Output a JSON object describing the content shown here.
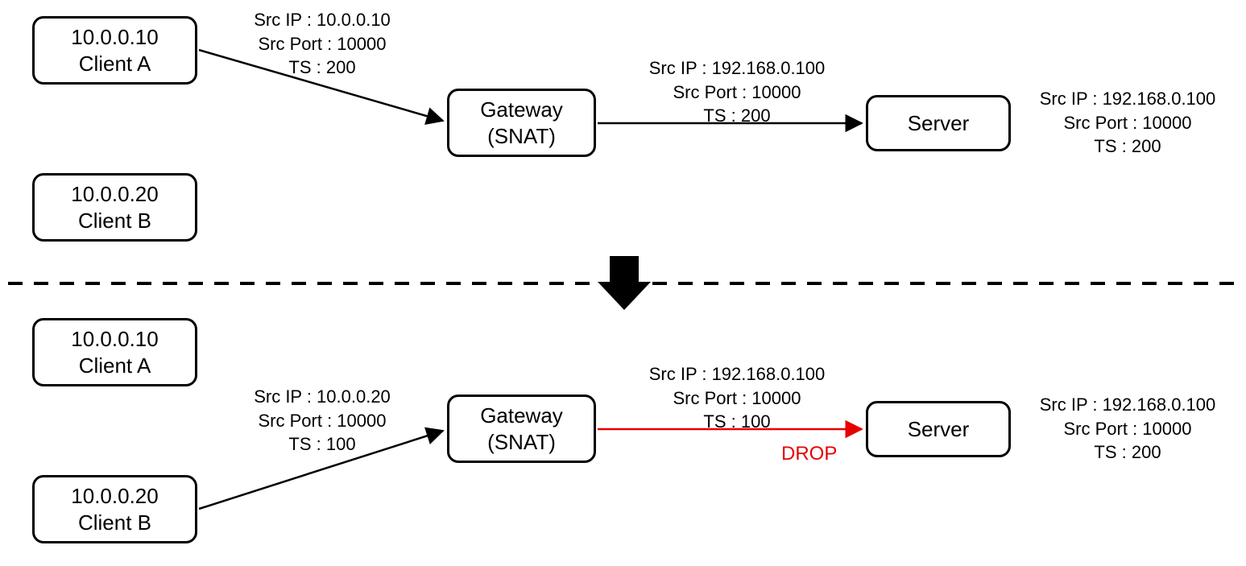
{
  "top": {
    "clientA": {
      "ip": "10.0.0.10",
      "label": "Client A"
    },
    "clientB": {
      "ip": "10.0.0.20",
      "label": "Client B"
    },
    "gateway": {
      "line1": "Gateway",
      "line2": "(SNAT)"
    },
    "server": {
      "label": "Server"
    },
    "pkt_client_to_gw": {
      "src_ip": "Src IP : 10.0.0.10",
      "src_port": "Src Port : 10000",
      "ts": "TS : 200"
    },
    "pkt_gw_to_server": {
      "src_ip": "Src IP : 192.168.0.100",
      "src_port": "Src Port : 10000",
      "ts": "TS : 200"
    },
    "pkt_server_state": {
      "src_ip": "Src IP : 192.168.0.100",
      "src_port": "Src Port : 10000",
      "ts": "TS : 200"
    }
  },
  "bottom": {
    "clientA": {
      "ip": "10.0.0.10",
      "label": "Client A"
    },
    "clientB": {
      "ip": "10.0.0.20",
      "label": "Client B"
    },
    "gateway": {
      "line1": "Gateway",
      "line2": "(SNAT)"
    },
    "server": {
      "label": "Server"
    },
    "pkt_client_to_gw": {
      "src_ip": "Src IP : 10.0.0.20",
      "src_port": "Src Port : 10000",
      "ts": "TS : 100"
    },
    "pkt_gw_to_server": {
      "src_ip": "Src IP : 192.168.0.100",
      "src_port": "Src Port : 10000",
      "ts": "TS : 100"
    },
    "pkt_server_state": {
      "src_ip": "Src IP : 192.168.0.100",
      "src_port": "Src Port : 10000",
      "ts": "TS : 200"
    },
    "drop_label": "DROP"
  }
}
